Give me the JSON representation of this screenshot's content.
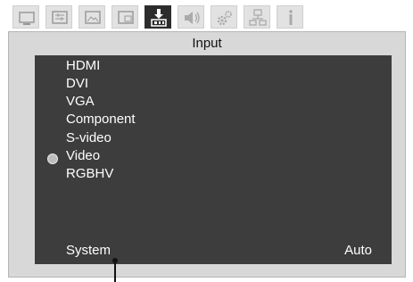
{
  "tabs": [
    {
      "icon": "monitor-icon",
      "active": false
    },
    {
      "icon": "image-adjust-icon",
      "active": false
    },
    {
      "icon": "screen-icon",
      "active": false
    },
    {
      "icon": "picture-in-picture-icon",
      "active": false
    },
    {
      "icon": "input-download-icon",
      "active": true
    },
    {
      "icon": "audio-volume-icon",
      "active": false
    },
    {
      "icon": "gears-settings-icon",
      "active": false
    },
    {
      "icon": "network-icon",
      "active": false
    },
    {
      "icon": "info-icon",
      "active": false
    }
  ],
  "panel": {
    "title": "Input",
    "items": [
      "HDMI",
      "DVI",
      "VGA",
      "Component",
      "S-video",
      "Video",
      "RGBHV"
    ],
    "selected_index": 5,
    "system_label": "System",
    "system_value": "Auto"
  },
  "colors": {
    "list_bg": "#3d3d3d",
    "panel_bg": "#d8d8d8",
    "tab_bg": "#e2e2e2",
    "tab_active_bg": "#2c2c2c"
  }
}
